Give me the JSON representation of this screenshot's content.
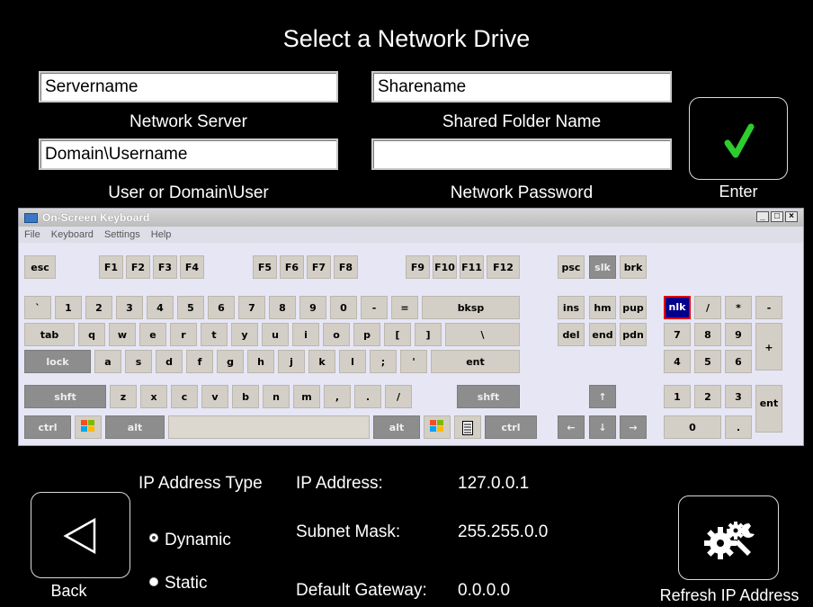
{
  "title": "Select a Network Drive",
  "fields": {
    "server": {
      "value": "Servername",
      "label": "Network Server"
    },
    "share": {
      "value": "Sharename",
      "label": "Shared Folder Name"
    },
    "user": {
      "value": "Domain\\Username",
      "label": "User or Domain\\User"
    },
    "password": {
      "value": "",
      "label": "Network Password"
    }
  },
  "enter": {
    "label": "Enter",
    "icon": "checkmark-icon",
    "icon_color": "#2ecc2e"
  },
  "osk": {
    "title": "On-Screen Keyboard",
    "menu": [
      "File",
      "Keyboard",
      "Settings",
      "Help"
    ],
    "controls": [
      "_",
      "□",
      "×"
    ],
    "keys": {
      "esc": "esc",
      "f": [
        "F1",
        "F2",
        "F3",
        "F4",
        "F5",
        "F6",
        "F7",
        "F8",
        "F9",
        "F10",
        "F11",
        "F12"
      ],
      "psc": "psc",
      "slk": "slk",
      "brk": "brk",
      "num_row": [
        "`",
        "1",
        "2",
        "3",
        "4",
        "5",
        "6",
        "7",
        "8",
        "9",
        "0",
        "-",
        "="
      ],
      "bksp": "bksp",
      "ins": "ins",
      "hm": "hm",
      "pup": "pup",
      "nlk": "nlk",
      "np_slash": "/",
      "np_star": "*",
      "np_minus": "-",
      "tab": "tab",
      "q_row": [
        "q",
        "w",
        "e",
        "r",
        "t",
        "y",
        "u",
        "i",
        "o",
        "p",
        "[",
        "]",
        "\\"
      ],
      "del": "del",
      "end": "end",
      "pdn": "pdn",
      "np_row1": [
        "7",
        "8",
        "9"
      ],
      "np_plus": "+",
      "lock": "lock",
      "a_row": [
        "a",
        "s",
        "d",
        "f",
        "g",
        "h",
        "j",
        "k",
        "l",
        ";",
        "'"
      ],
      "ent": "ent",
      "np_row2": [
        "4",
        "5",
        "6"
      ],
      "shft": "shft",
      "z_row": [
        "z",
        "x",
        "c",
        "v",
        "b",
        "n",
        "m",
        ",",
        ".",
        "/"
      ],
      "up": "↑",
      "np_row3": [
        "1",
        "2",
        "3"
      ],
      "ctrl": "ctrl",
      "alt": "alt",
      "left": "←",
      "down": "↓",
      "right": "→",
      "np_0": "0",
      "np_dot": ".",
      "np_ent": "ent"
    }
  },
  "ip": {
    "type_label": "IP Address Type",
    "options": [
      "Dynamic",
      "Static"
    ],
    "selected": "Dynamic",
    "address_label": "IP Address:",
    "address": "127.0.0.1",
    "subnet_label": "Subnet Mask:",
    "subnet": "255.255.0.0",
    "gateway_label": "Default Gateway:",
    "gateway": "0.0.0.0"
  },
  "back": {
    "label": "Back",
    "icon": "left-triangle-icon"
  },
  "refresh": {
    "label": "Refresh IP Address",
    "icon": "gears-icon"
  }
}
